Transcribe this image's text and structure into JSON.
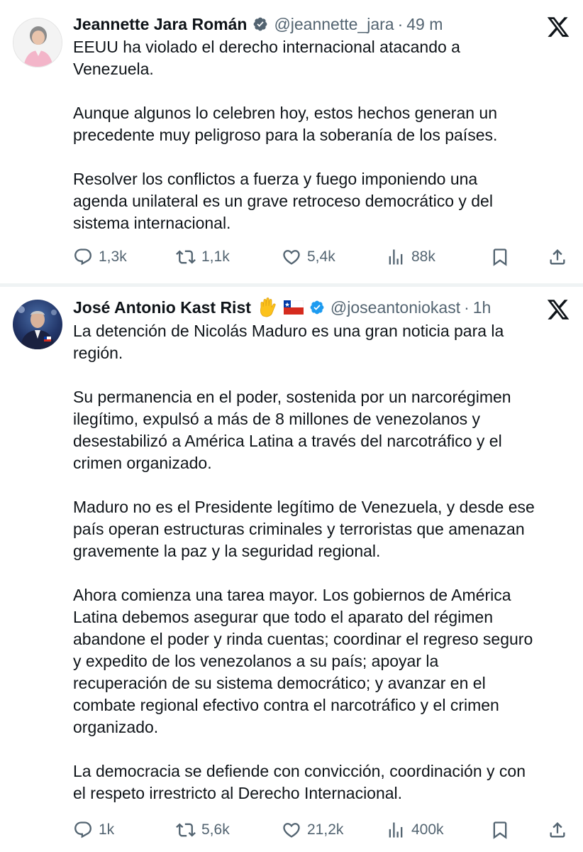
{
  "tweets": [
    {
      "name": "Jeannette Jara Román",
      "handle": "@jeannette_jara",
      "separator": "·",
      "time": "49 m",
      "paragraphs": [
        [
          "EEUU ha violado el derecho internacional atacando  a",
          "Venezuela."
        ],
        [
          "Aunque algunos lo celebren hoy, estos hechos generan  un",
          "precedente muy peligroso para la soberanía de los países."
        ],
        [
          "Resolver los conflictos a fuerza y fuego imponiendo una",
          "agenda unilateral es un grave retroceso democrático y del",
          "sistema internacional."
        ]
      ],
      "stats": {
        "replies": "1,3k",
        "reposts": "1,1k",
        "likes": "5,4k",
        "views": "88k"
      }
    },
    {
      "name": "José Antonio Kast Rist",
      "emojis": [
        "raised-hand-emoji",
        "chile-flag-emoji"
      ],
      "handle": "@joseantoniokast",
      "separator": "·",
      "time": "1h",
      "paragraphs": [
        [
          "La detención de Nicolás Maduro es una gran noticia para la",
          "región."
        ],
        [
          "Su permanencia en el poder, sostenida por un narcorégimen",
          "ilegítimo, expulsó a más de 8 millones de venezolanos y",
          "desestabilizó a América Latina a través del narcotráfico y el",
          "crimen organizado."
        ],
        [
          "Maduro no es el Presidente legítimo de Venezuela, y desde ese",
          "país operan estructuras criminales y terroristas que amenazan",
          "gravemente la paz y la seguridad regional."
        ],
        [
          "Ahora comienza una tarea mayor. Los gobiernos de América",
          "Latina debemos asegurar que todo el aparato del régimen",
          "abandone el poder y rinda cuentas; coordinar el regreso seguro",
          "y expedito de los venezolanos a su país; apoyar la",
          "recuperación de su sistema democrático; y avanzar en el",
          "combate regional efectivo contra el narcotráfico y el crimen",
          "organizado."
        ],
        [
          "La democracia se defiende con convicción, coordinación y con",
          "el respeto irrestricto al Derecho Internacional."
        ]
      ],
      "stats": {
        "replies": "1k",
        "reposts": "5,6k",
        "likes": "21,2k",
        "views": "400k"
      }
    }
  ],
  "icons": [
    "x-logo-icon",
    "verified-badge-icon",
    "reply-icon",
    "repost-icon",
    "like-icon",
    "views-icon",
    "bookmark-icon",
    "share-icon"
  ],
  "colors": {
    "text": "#0f1419",
    "secondary": "#536471",
    "verified": "#1d9bf0",
    "divider": "#eff3f4",
    "background": "#ffffff"
  }
}
